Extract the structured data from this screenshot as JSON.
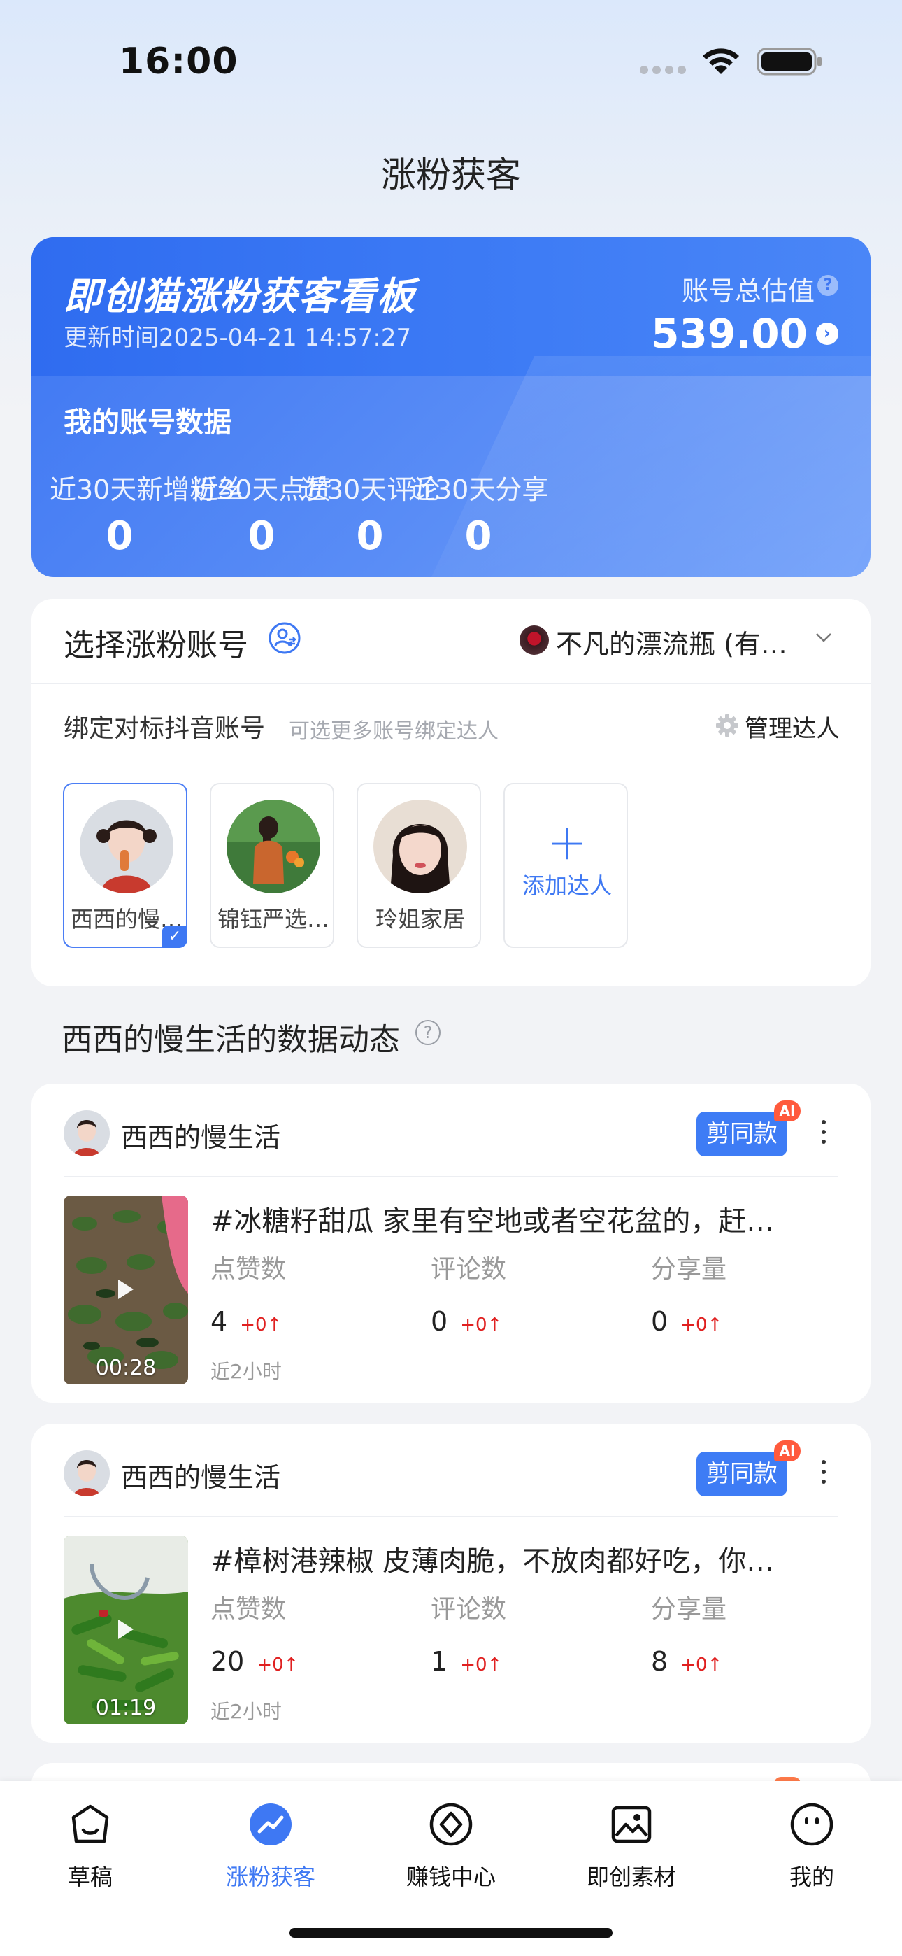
{
  "status_bar": {
    "time": "16:00"
  },
  "nav": {
    "title": "涨粉获客"
  },
  "dashboard": {
    "title": "即创猫涨粉获客看板",
    "update_time": "更新时间2025-04-21 14:57:27",
    "value_label": "账号总估值",
    "value": "539.00",
    "section_label": "我的账号数据",
    "stats": [
      {
        "label": "近30天新增粉丝",
        "value": "0"
      },
      {
        "label": "近30天点赞",
        "value": "0"
      },
      {
        "label": "近30天评论",
        "value": "0"
      },
      {
        "label": "近30天分享",
        "value": "0"
      }
    ]
  },
  "account": {
    "title": "选择涨粉账号",
    "selected_account": "不凡的漂流瓶 (有…",
    "bind_title": "绑定对标抖音账号",
    "bind_hint": "可选更多账号绑定达人",
    "manage_label": "管理达人",
    "talents": [
      {
        "name": "西西的慢…",
        "selected": true
      },
      {
        "name": "锦钰严选…",
        "selected": false
      },
      {
        "name": "玲姐家居",
        "selected": false
      }
    ],
    "add_label": "添加达人"
  },
  "section": {
    "title": "西西的慢生活的数据动态"
  },
  "posts": [
    {
      "author": "西西的慢生活",
      "button": "剪同款",
      "ai_badge": "AI",
      "title": "#冰糖籽甜瓜 家里有空地或者空花盆的，赶…",
      "duration": "00:28",
      "metrics": [
        {
          "label": "点赞数",
          "value": "4",
          "delta": "+0↑"
        },
        {
          "label": "评论数",
          "value": "0",
          "delta": "+0↑"
        },
        {
          "label": "分享量",
          "value": "0",
          "delta": "+0↑"
        }
      ],
      "time": "近2小时"
    },
    {
      "author": "西西的慢生活",
      "button": "剪同款",
      "ai_badge": "AI",
      "title": "#樟树港辣椒 皮薄肉脆，不放肉都好吃，你…",
      "duration": "01:19",
      "metrics": [
        {
          "label": "点赞数",
          "value": "20",
          "delta": "+0↑"
        },
        {
          "label": "评论数",
          "value": "1",
          "delta": "+0↑"
        },
        {
          "label": "分享量",
          "value": "8",
          "delta": "+0↑"
        }
      ],
      "time": "近2小时"
    }
  ],
  "tabs": [
    {
      "label": "草稿",
      "icon": "draft-icon"
    },
    {
      "label": "涨粉获客",
      "icon": "growth-icon",
      "active": true
    },
    {
      "label": "赚钱中心",
      "icon": "earn-icon"
    },
    {
      "label": "即创素材",
      "icon": "material-icon"
    },
    {
      "label": "我的",
      "icon": "profile-icon"
    }
  ],
  "colors": {
    "accent": "#3e78f3",
    "delta_red": "#e02020",
    "ai_badge": "#ff5a3c"
  }
}
